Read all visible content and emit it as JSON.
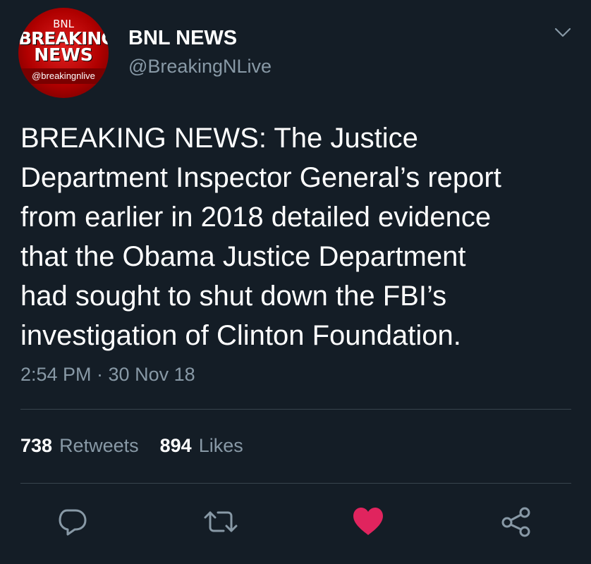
{
  "author": {
    "display_name": "BNL NEWS",
    "screen_name": "@BreakingNLive",
    "avatar": {
      "top_text": "BNL",
      "line1": "BREAKING",
      "line2": "NEWS",
      "handle": "@breakingnlive"
    }
  },
  "tweet": {
    "text": "BREAKING NEWS: The Justice\nDepartment Inspector General’s report\nfrom earlier in 2018 detailed evidence\nthat the Obama Justice Department\nhad sought to shut down the FBI’s\ninvestigation of Clinton Foundation.",
    "timestamp": "2:54 PM · 30 Nov 18"
  },
  "stats": {
    "retweets_count": "738",
    "retweets_label": "Retweets",
    "likes_count": "894",
    "likes_label": "Likes"
  },
  "actions": {
    "reply_icon": "reply-icon",
    "retweet_icon": "retweet-icon",
    "like_icon": "heart-icon",
    "share_icon": "share-icon",
    "like_active": true
  },
  "colors": {
    "background": "#141d26",
    "secondary_text": "#8899a6",
    "like_active": "#e0245e",
    "divider": "#38444d"
  }
}
